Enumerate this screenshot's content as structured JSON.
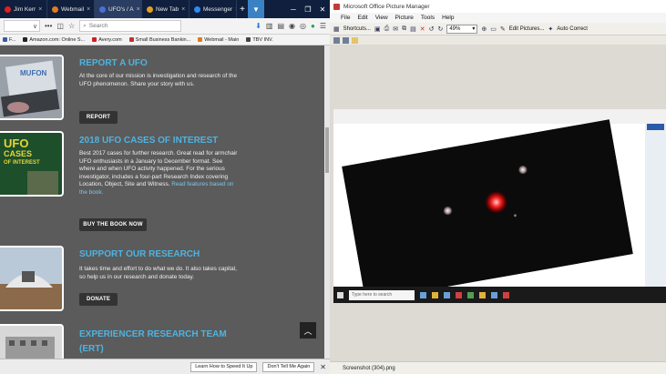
{
  "firefox": {
    "tabs": [
      {
        "label": "Jim Kerr",
        "color": "#e02020"
      },
      {
        "label": "Webmail",
        "color": "#e07a20"
      },
      {
        "label": "UFO's / A",
        "color": "#4a6fd8"
      },
      {
        "label": "New Tab",
        "color": "#e0a020"
      },
      {
        "label": "Messenger",
        "color": "#2a8cf0"
      }
    ],
    "search_placeholder": "Search",
    "url_text": "∨",
    "bookmarks": [
      {
        "label": "F...",
        "color": "#3b5ba0"
      },
      {
        "label": "Amazon.com: Online S...",
        "color": "#222222"
      },
      {
        "label": "Avery.com",
        "color": "#cc2222"
      },
      {
        "label": "Small Business Bankin...",
        "color": "#c43030"
      },
      {
        "label": "Webmail - Main",
        "color": "#e07a20"
      },
      {
        "label": "TBV INV.",
        "color": "#444444"
      }
    ],
    "sections": [
      {
        "title": "REPORT A UFO",
        "body": "At the core of our mission is investigation and research of the UFO phenomenon. Share your story with us.",
        "button": "REPORT"
      },
      {
        "title": "2018 UFO CASES OF INTEREST",
        "body": "Best 2017 cases for further research. Great read for armchair UFO enthusiasts in a January to December format. See where and when UFO activity happened. For the serious investigator, includes a four-part Research Index covering Location, Object, Site and Witness.",
        "link": "Read features based on the book.",
        "button": "BUY THE BOOK NOW"
      },
      {
        "title": "SUPPORT OUR RESEARCH",
        "body": "It takes time and effort to do what we do. It also takes capital, so help us in our research and donate today.",
        "button": "DONATE"
      },
      {
        "title": "EXPERIENCER RESEARCH TEAM",
        "title2": "(ERT)"
      }
    ],
    "thumb_mufon": "MUFON",
    "thumb_book_line1": "UFO",
    "thumb_book_line2": "CASES",
    "thumb_book_line3": "OF INTEREST",
    "notification": {
      "learn_label": "Learn How to Speed It Up",
      "dont_tell_label": "Don't Tell Me Again"
    }
  },
  "picture_manager": {
    "title": "Microsoft Office Picture Manager",
    "menu": [
      "File",
      "Edit",
      "View",
      "Picture",
      "Tools",
      "Help"
    ],
    "shortcuts_label": "Shortcuts...",
    "zoom_value": "49%",
    "edit_pictures_label": "Edit Pictures...",
    "auto_correct_label": "Auto Correct",
    "taskbar_search": "Type here to search",
    "status_text": "Screenshot (304).png"
  }
}
